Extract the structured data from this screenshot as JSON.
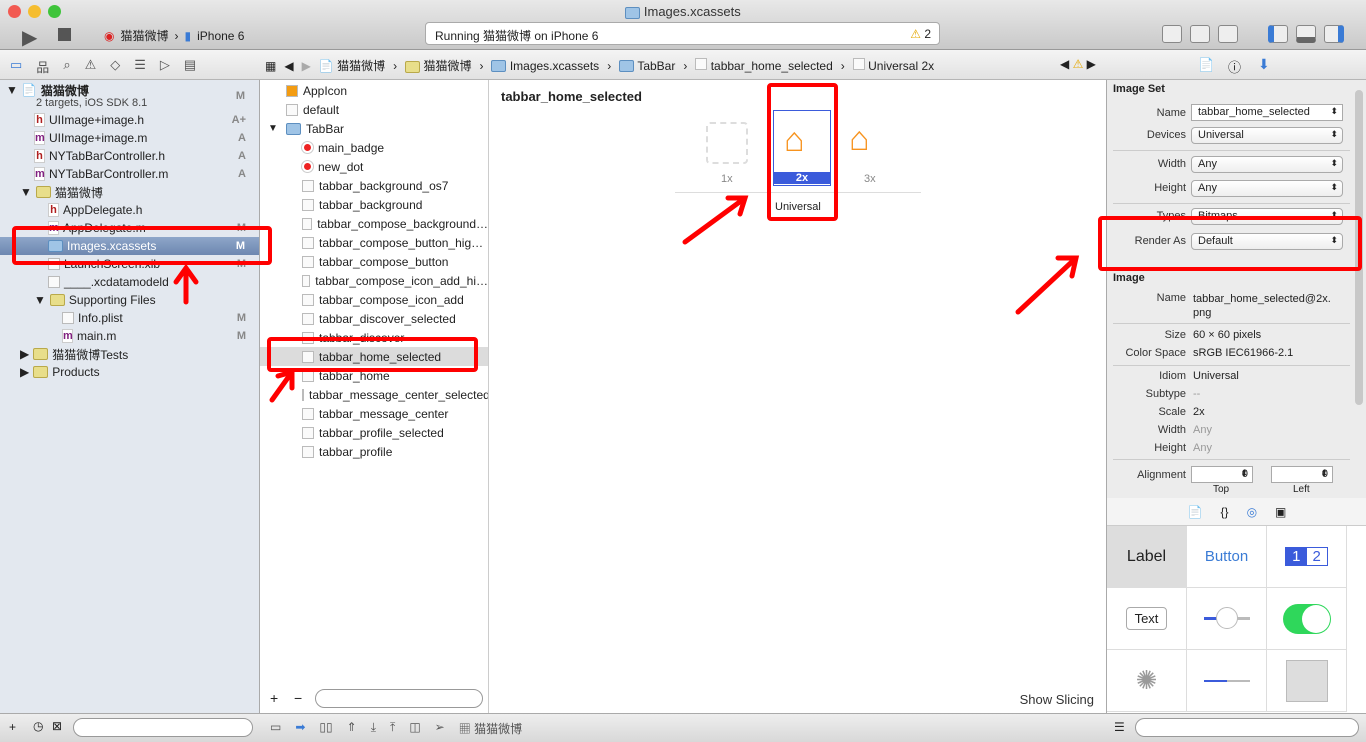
{
  "window": {
    "title": "Images.xcassets",
    "scheme": "猫猫微博",
    "device": "iPhone 6",
    "status": "Running 猫猫微博 on iPhone 6",
    "warnings": "2"
  },
  "jumpbar": [
    "猫猫微博",
    "猫猫微博",
    "Images.xcassets",
    "TabBar",
    "tabbar_home_selected",
    "Universal 2x"
  ],
  "navigator": {
    "items": [
      {
        "label": "猫猫微博",
        "badge": "M",
        "icon": "project-icon"
      },
      {
        "label": "2 targets, iOS SDK 8.1"
      },
      {
        "label": "UIImage+image.h",
        "badge": "A+",
        "icon": "h"
      },
      {
        "label": "UIImage+image.m",
        "badge": "A",
        "icon": "m"
      },
      {
        "label": "NYTabBarController.h",
        "badge": "A",
        "icon": "h"
      },
      {
        "label": "NYTabBarController.m",
        "badge": "A",
        "icon": "m"
      },
      {
        "label": "猫猫微博",
        "icon": "folder"
      },
      {
        "label": "AppDelegate.h",
        "icon": "h"
      },
      {
        "label": "AppDelegate.m",
        "badge": "M",
        "icon": "m"
      },
      {
        "label": "Images.xcassets",
        "badge": "M",
        "icon": "assets"
      },
      {
        "label": "LaunchScreen.xib",
        "badge": "M",
        "icon": "xib"
      },
      {
        "label": "____.xcdatamodeld",
        "icon": "model"
      },
      {
        "label": "Supporting Files",
        "icon": "folder"
      },
      {
        "label": "Info.plist",
        "badge": "M",
        "icon": "plist"
      },
      {
        "label": "main.m",
        "badge": "M",
        "icon": "m"
      },
      {
        "label": "猫猫微博Tests",
        "icon": "folder"
      },
      {
        "label": "Products",
        "icon": "folder"
      }
    ]
  },
  "assets": [
    "AppIcon",
    "default",
    "TabBar",
    "main_badge",
    "new_dot",
    "tabbar_background_os7",
    "tabbar_background",
    "tabbar_compose_background…",
    "tabbar_compose_button_hig…",
    "tabbar_compose_button",
    "tabbar_compose_icon_add_hi…",
    "tabbar_compose_icon_add",
    "tabbar_discover_selected",
    "tabbar_discover",
    "tabbar_home_selected",
    "tabbar_home",
    "tabbar_message_center_selected",
    "tabbar_message_center",
    "tabbar_profile_selected",
    "tabbar_profile"
  ],
  "canvas": {
    "title": "tabbar_home_selected",
    "slots": [
      "1x",
      "2x",
      "3x"
    ],
    "group": "Universal",
    "show_slicing": "Show Slicing"
  },
  "inspector": {
    "image_set": {
      "header": "Image Set",
      "name_label": "Name",
      "name": "tabbar_home_selected",
      "devices_label": "Devices",
      "devices": "Universal",
      "width_label": "Width",
      "width": "Any",
      "height_label": "Height",
      "height": "Any",
      "types_label": "Types",
      "types": "Bitmaps",
      "render_label": "Render As",
      "render": "Default"
    },
    "image": {
      "header": "Image",
      "name_label": "Name",
      "name": "tabbar_home_selected@2x.png",
      "size_label": "Size",
      "size": "60 × 60 pixels",
      "cs_label": "Color Space",
      "cs": "sRGB IEC61966-2.1",
      "idiom_label": "Idiom",
      "idiom": "Universal",
      "subtype_label": "Subtype",
      "subtype": "--",
      "scale_label": "Scale",
      "scale": "2x",
      "width_label": "Width",
      "width": "Any",
      "height_label": "Height",
      "height": "Any",
      "align_label": "Alignment",
      "top": "0",
      "left": "0",
      "top_label": "Top",
      "left_label": "Left"
    }
  },
  "library": {
    "label": "Label",
    "button": "Button",
    "seg1": "1",
    "seg2": "2",
    "text": "Text"
  },
  "debug": {
    "target": "猫猫微博"
  },
  "colors": {
    "accent": "#f7931e",
    "selection": "#3b5bdb",
    "annotation": "#ff0000"
  }
}
